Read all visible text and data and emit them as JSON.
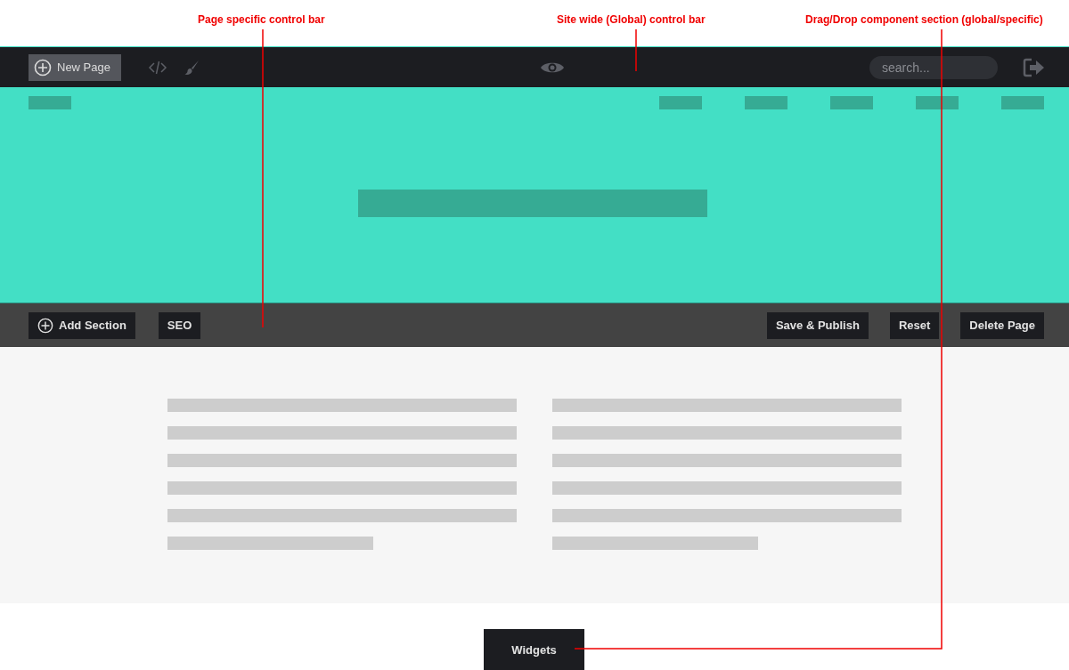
{
  "annotations": [
    {
      "text": "Page specific control bar"
    },
    {
      "text": "Site wide (Global) control bar"
    },
    {
      "text": "Drag/Drop component section (global/specific)"
    }
  ],
  "global_bar": {
    "new_page_button": "New Page",
    "search": {
      "placeholder": "search..."
    }
  },
  "page_bar": {
    "left_buttons": [
      {
        "label": "Add Section",
        "kind": "add"
      },
      {
        "label": "SEO",
        "kind": "plain"
      }
    ],
    "right_buttons": [
      "Save & Publish",
      "Reset",
      "Delete Page"
    ]
  },
  "widgets_button": "Widgets"
}
